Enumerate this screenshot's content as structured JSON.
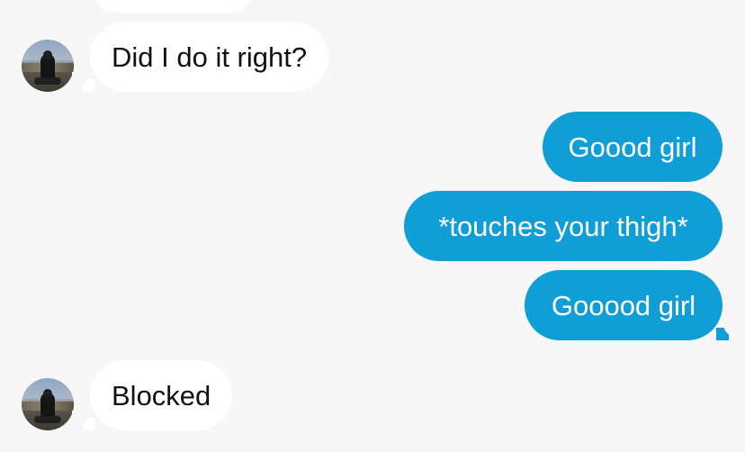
{
  "messages": [
    {
      "sender": "them",
      "text": "Did I do it right?"
    },
    {
      "sender": "me",
      "text": "Goood girl"
    },
    {
      "sender": "me",
      "text": "*touches your thigh*"
    },
    {
      "sender": "me",
      "text": "Gooood girl"
    },
    {
      "sender": "them",
      "text": "Blocked"
    }
  ],
  "colors": {
    "background": "#f7f7f7",
    "incoming_bubble": "#ffffff",
    "outgoing_bubble": "#0f9ed6",
    "incoming_text": "#111111",
    "outgoing_text": "#ffffff"
  }
}
